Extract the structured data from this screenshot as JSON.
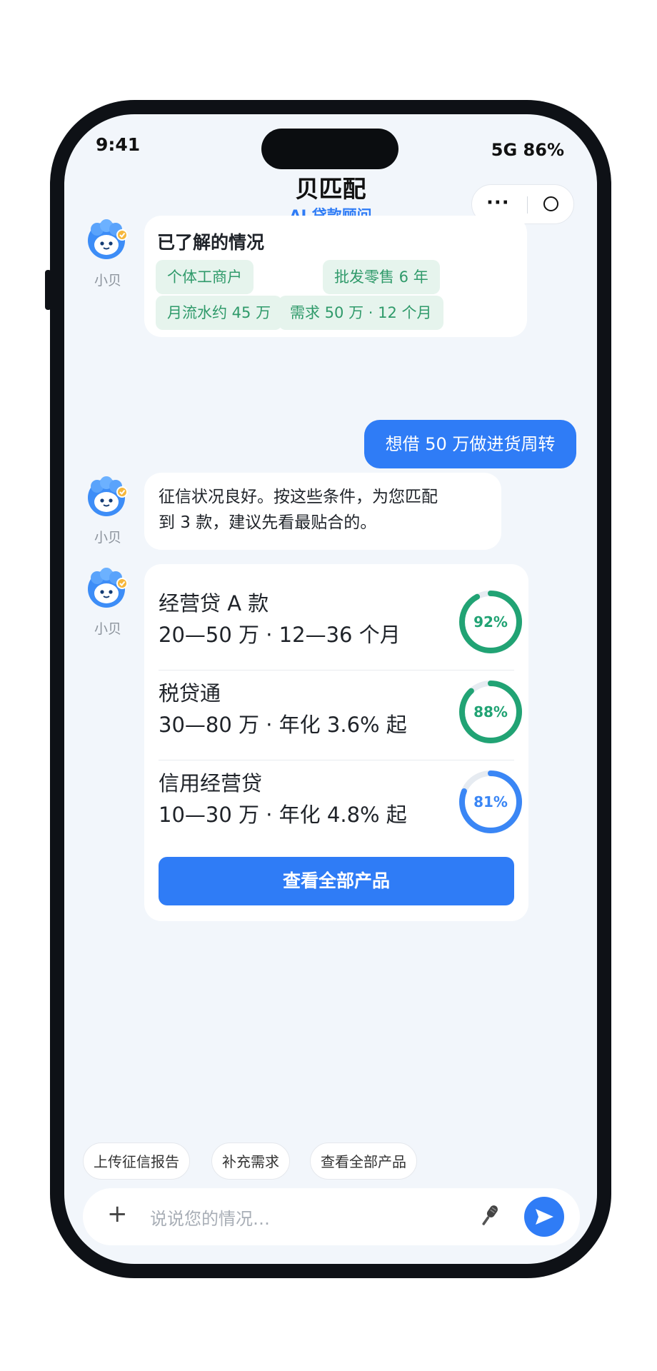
{
  "status_bar": {
    "time": "9:41",
    "network_battery": "5G 86%"
  },
  "header": {
    "title": "贝匹配",
    "subtitle": "AI 贷款顾问",
    "more_label": "···"
  },
  "assistant": {
    "name": "小贝"
  },
  "messages": {
    "known_info": {
      "title": "已了解的情况",
      "tags": [
        "个体工商户",
        "批发零售 6 年",
        "月流水约 45 万",
        "需求 50 万 · 12 个月"
      ]
    },
    "user_message": "想借 50 万做进货周转",
    "assistant_reply": [
      "征信状况良好。按这些条件，为您匹配",
      "到 3 款，建议先看最贴合的。"
    ],
    "products": [
      {
        "name": "经营贷 A 款",
        "desc": "20—50 万 · 12—36 个月",
        "match_percent": 92,
        "match_label": "92%",
        "color": "#21a374"
      },
      {
        "name": "税贷通",
        "desc": "30—80 万 · 年化 3.6% 起",
        "match_percent": 88,
        "match_label": "88%",
        "color": "#21a374"
      },
      {
        "name": "信用经营贷",
        "desc": "10—30 万 · 年化 4.8% 起",
        "match_percent": 81,
        "match_label": "81%",
        "color": "#3a86f5"
      }
    ],
    "view_all_button": "查看全部产品"
  },
  "quick_replies": [
    "上传征信报告",
    "补充需求",
    "查看全部产品"
  ],
  "composer": {
    "placeholder": "说说您的情况…",
    "plus": "+"
  }
}
